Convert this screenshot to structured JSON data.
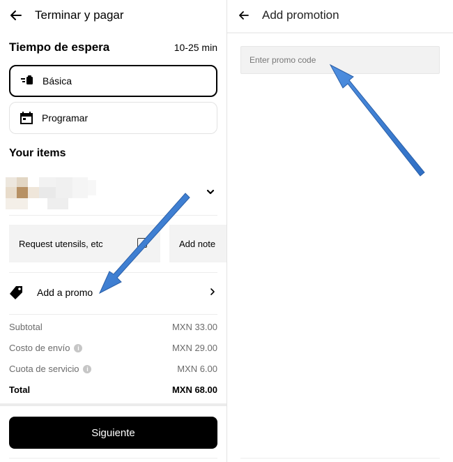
{
  "left": {
    "header": {
      "title": "Terminar y pagar",
      "back_icon": "arrow-left-icon"
    },
    "wait": {
      "title": "Tiempo de espera",
      "time": "10-25 min"
    },
    "options": [
      {
        "label": "Básica",
        "icon": "delivery-icon",
        "selected": true
      },
      {
        "label": "Programar",
        "icon": "calendar-icon",
        "selected": false
      }
    ],
    "items_title": "Your items",
    "cards": {
      "utensils": "Request utensils, etc",
      "note": "Add note"
    },
    "promo": {
      "label": "Add a promo",
      "icon": "tag-icon"
    },
    "summary": [
      {
        "label": "Subtotal",
        "value": "MXN 33.00",
        "info": false
      },
      {
        "label": "Costo de envío",
        "value": "MXN 29.00",
        "info": true
      },
      {
        "label": "Cuota de servicio",
        "value": "MXN 6.00",
        "info": true
      },
      {
        "label": "Total",
        "value": "MXN 68.00",
        "info": false
      }
    ],
    "next_button": "Siguiente"
  },
  "right": {
    "header": {
      "title": "Add promotion",
      "back_icon": "arrow-left-icon"
    },
    "input": {
      "placeholder": "Enter promo code",
      "value": ""
    }
  },
  "colors": {
    "accent_arrow": "#3a7bd5",
    "primary": "#000000"
  }
}
